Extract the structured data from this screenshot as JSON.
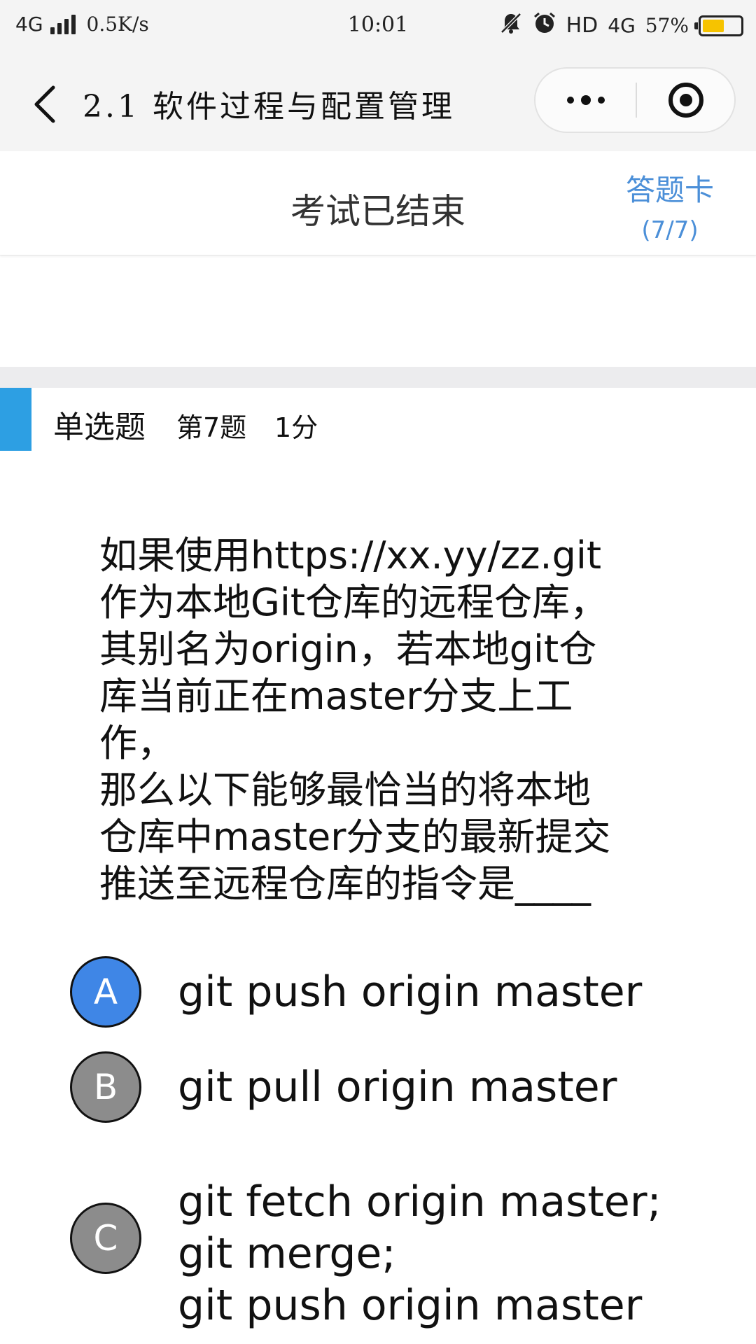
{
  "status_bar": {
    "network": "4G",
    "speed": "0.5K/s",
    "time": "10:01",
    "hd": "HD",
    "network_right": "4G",
    "battery_percent": "57%",
    "battery_level": 0.57
  },
  "nav": {
    "title": "2.1 软件过程与配置管理"
  },
  "exam": {
    "status": "考试已结束",
    "answer_card_label": "答题卡",
    "answer_card_progress": "(7/7)"
  },
  "question": {
    "type": "单选题",
    "number": "第7题",
    "score": "1分",
    "text": "如果使用https://xx.yy/zz.git\n作为本地Git仓库的远程仓库，\n其别名为origin，若本地git仓\n库当前正在master分支上工作，\n那么以下能够最恰当的将本地\n仓库中master分支的最新提交\n推送至远程仓库的指令是____",
    "options": [
      {
        "letter": "A",
        "text": "git push origin master",
        "selected": true
      },
      {
        "letter": "B",
        "text": "git pull origin master",
        "selected": false
      },
      {
        "letter": "C",
        "text": "git fetch origin master;\ngit merge;\ngit push origin master",
        "selected": false
      }
    ]
  },
  "colors": {
    "accent_blue": "#4b8fd8",
    "selected_option": "#3f86e6",
    "unselected_option": "#8c8c8c",
    "question_marker": "#2d9fe3",
    "battery_fill": "#f6c300"
  }
}
